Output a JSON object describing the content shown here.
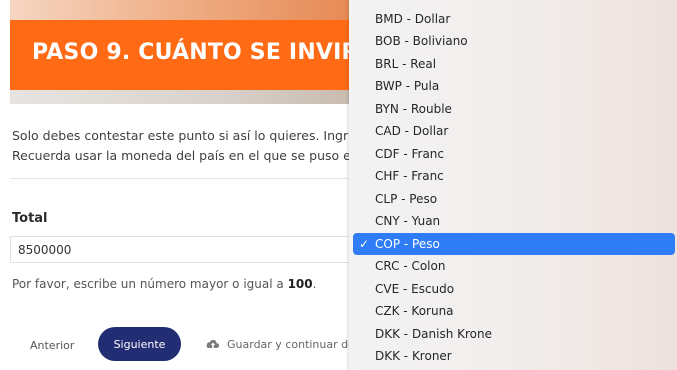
{
  "banner": {
    "title": "PASO 9. CUÁNTO SE INVIRTIC"
  },
  "instructions": {
    "line1": "Solo debes contestar este punto si así lo quieres. Ingr",
    "line2": "Recuerda usar la moneda del país en el que se puso e"
  },
  "total_field": {
    "label": "Total",
    "value": "8500000"
  },
  "hint": {
    "prefix": "Por favor, escribe un número mayor o igual a ",
    "minimum": "100",
    "suffix": "."
  },
  "buttons": {
    "previous": "Anterior",
    "next": "Siguiente",
    "save": "Guardar y continuar de"
  },
  "currency_dropdown": {
    "items": [
      "BMD - Dollar",
      "BOB - Boliviano",
      "BRL - Real",
      "BWP - Pula",
      "BYN - Rouble",
      "CAD - Dollar",
      "CDF - Franc",
      "CHF - Franc",
      "CLP - Peso",
      "CNY - Yuan",
      "COP - Peso",
      "CRC - Colon",
      "CVE - Escudo",
      "CZK - Koruna",
      "DKK - Danish Krone",
      "DKK - Kroner"
    ],
    "selected": "COP - Peso",
    "selected_index": 10,
    "check_glyph": "✓"
  },
  "colors": {
    "banner_orange": "#ff6a14",
    "next_button": "#232d74",
    "selection_blue": "#2e7cf6"
  }
}
